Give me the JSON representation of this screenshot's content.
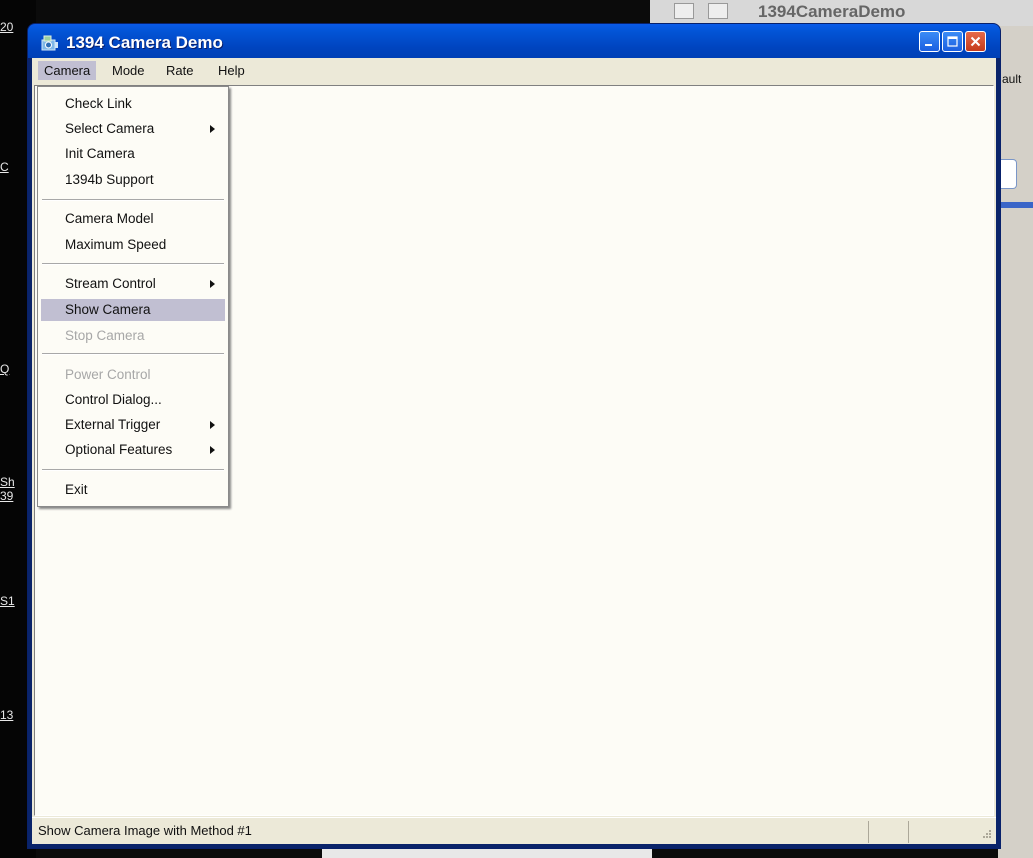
{
  "background": {
    "left_labels": [
      "20",
      "C",
      "Q",
      "Sh",
      "39",
      "S1",
      "13"
    ],
    "top_right_title": "1394CameraDemo",
    "right_panel_text": "ault"
  },
  "window": {
    "title": "1394 Camera Demo",
    "icon": "camera-app-icon",
    "controls": [
      "minimize-icon",
      "maximize-icon",
      "close-icon"
    ]
  },
  "menubar": {
    "items": [
      {
        "label": "Camera"
      },
      {
        "label": "Mode"
      },
      {
        "label": "Rate"
      },
      {
        "label": "Help"
      }
    ]
  },
  "camera_menu": {
    "items": [
      {
        "label": "Check Link"
      },
      {
        "label": "Select Camera",
        "submenu": true
      },
      {
        "label": "Init Camera"
      },
      {
        "label": "1394b Support"
      },
      {
        "label": "Camera Model"
      },
      {
        "label": "Maximum Speed"
      },
      {
        "label": "Stream Control",
        "submenu": true
      },
      {
        "label": "Show Camera",
        "highlighted": true
      },
      {
        "label": "Stop Camera",
        "disabled": true
      },
      {
        "label": "Power Control",
        "disabled": true
      },
      {
        "label": "Control Dialog..."
      },
      {
        "label": "External Trigger",
        "submenu": true
      },
      {
        "label": "Optional Features",
        "submenu": true
      },
      {
        "label": "Exit"
      }
    ]
  },
  "statusbar": {
    "text": "Show Camera Image with Method #1"
  },
  "colors": {
    "titlebar": "#0054e3",
    "menu_highlight": "#c1bfd2",
    "client_bg": "#ece9d8",
    "work_bg": "#fdfcf6"
  }
}
